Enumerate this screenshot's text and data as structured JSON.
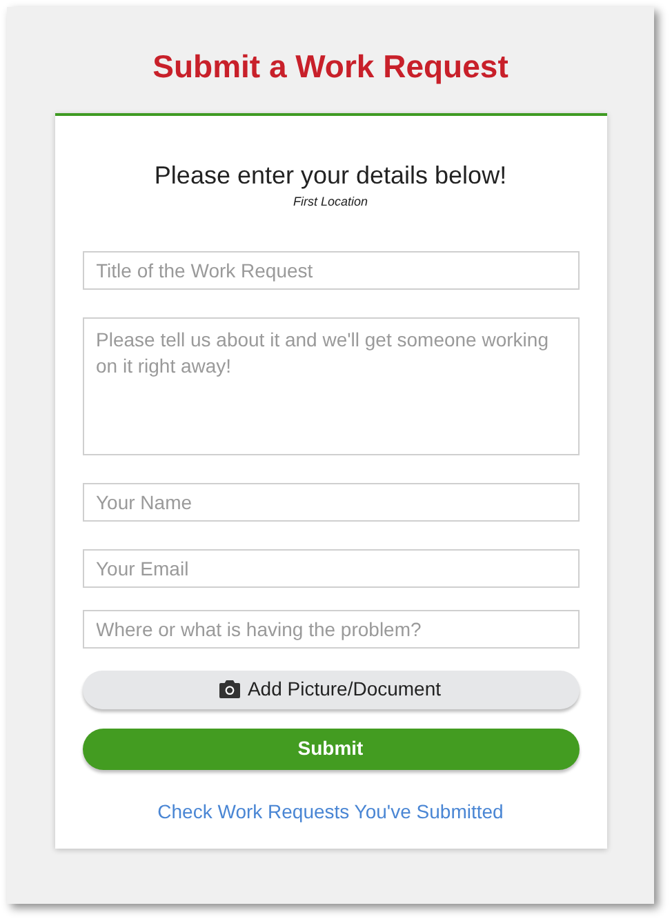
{
  "title": "Submit a Work Request",
  "heading": "Please enter your details below!",
  "location": "First Location",
  "fields": [
    {
      "kind": "input",
      "placeholder": "Title of the Work Request"
    },
    {
      "kind": "textarea",
      "placeholder": "Please tell us about it and we'll get someone working on it right away!"
    },
    {
      "kind": "input",
      "placeholder": "Your Name"
    },
    {
      "kind": "input",
      "placeholder": "Your Email"
    },
    {
      "kind": "input",
      "placeholder": "Where or what is having the problem?"
    }
  ],
  "attach_button": "Add Picture/Document",
  "submit_button": "Submit",
  "link": "Check Work Requests You've Submitted"
}
